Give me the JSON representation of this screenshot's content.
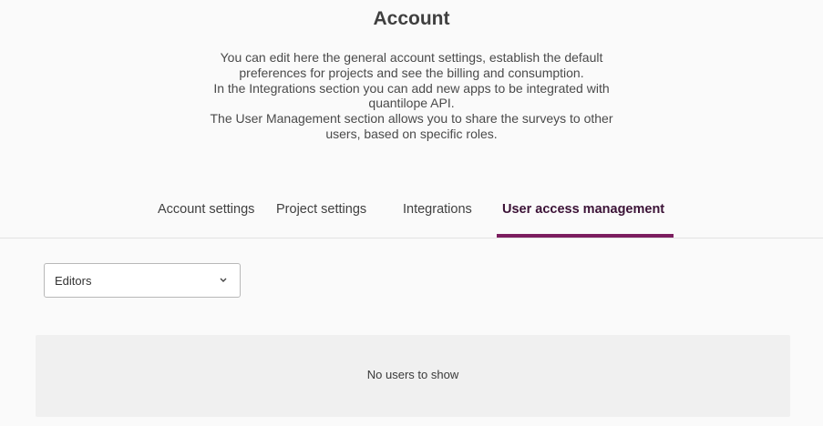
{
  "header": {
    "title": "Account",
    "description_lines": [
      "You can edit here the general account settings, establish the default",
      "preferences for projects and see the billing and consumption.",
      "In the Integrations section you can add new apps to be integrated with",
      "quantilope API.",
      "The User Management section allows you to share the surveys to other",
      "users, based on specific roles."
    ]
  },
  "tabs": [
    {
      "label": "Account settings",
      "active": false
    },
    {
      "label": "Project settings",
      "active": false
    },
    {
      "label": "Integrations",
      "active": false
    },
    {
      "label": "User access management",
      "active": true
    }
  ],
  "role_filter": {
    "selected": "Editors",
    "icon": "chevron-down-icon"
  },
  "users_panel": {
    "empty_message": "No users to show"
  },
  "colors": {
    "accent": "#7b1d5f",
    "active_tab_text": "#3b1236",
    "page_bg": "#fafafa",
    "panel_bg": "#f0f0f0"
  }
}
